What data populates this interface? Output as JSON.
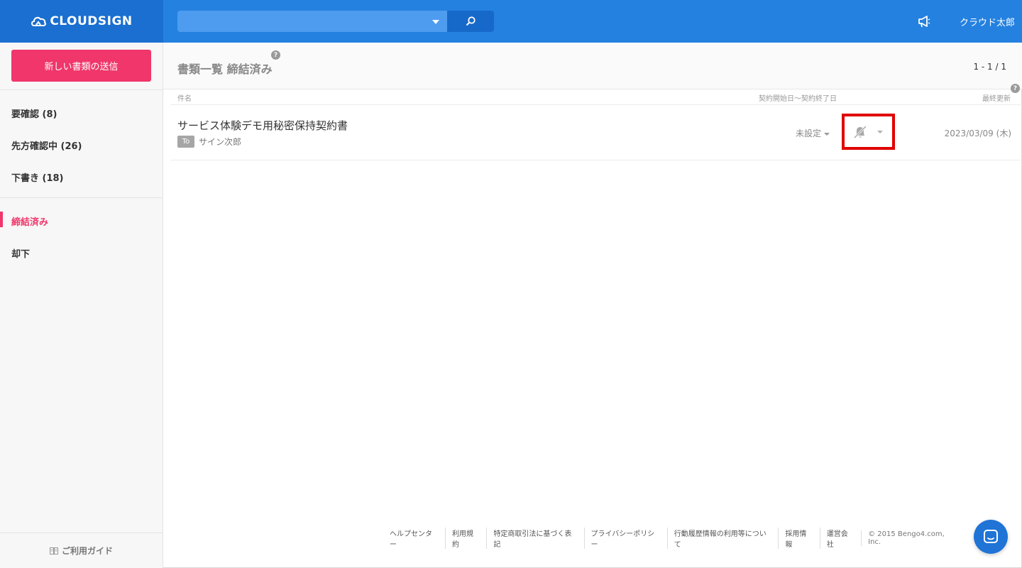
{
  "header": {
    "logo_text": "CLOUDSIGN",
    "search_placeholder": "",
    "user_name": "クラウド太郎"
  },
  "sidebar": {
    "new_doc_button": "新しい書類の送信",
    "items": [
      {
        "label": "要確認 (8)"
      },
      {
        "label": "先方確認中 (26)"
      },
      {
        "label": "下書き (18)"
      },
      {
        "label": "締結済み"
      },
      {
        "label": "却下"
      }
    ],
    "active_item": "締結済み",
    "guide_label": "ご利用ガイド"
  },
  "main": {
    "title": "書類一覧 締結済み",
    "help_mark": "?",
    "pagination": "1 - 1 / 1",
    "columns": {
      "name": "件名",
      "period": "契約開始日〜契約終了日",
      "updated": "最終更新"
    },
    "rows": [
      {
        "title": "サービス体験デモ用秘密保持契約書",
        "badge": "To",
        "recipient": "サイン次郎",
        "period": "未設定",
        "notification_icon": "bell-off-icon",
        "updated": "2023/03/09 (木)"
      }
    ]
  },
  "footer": {
    "links": [
      "ヘルプセンター",
      "利用規約",
      "特定商取引法に基づく表記",
      "プライバシーポリシー",
      "行動履歴情報の利用等について",
      "採用情報",
      "運営会社"
    ],
    "copyright": "© 2015 Bengo4.com, Inc."
  },
  "colors": {
    "header_blue": "#2481e0",
    "logo_blue": "#1a6fd0",
    "accent_pink": "#f0366a",
    "highlight_red": "#e00000"
  }
}
